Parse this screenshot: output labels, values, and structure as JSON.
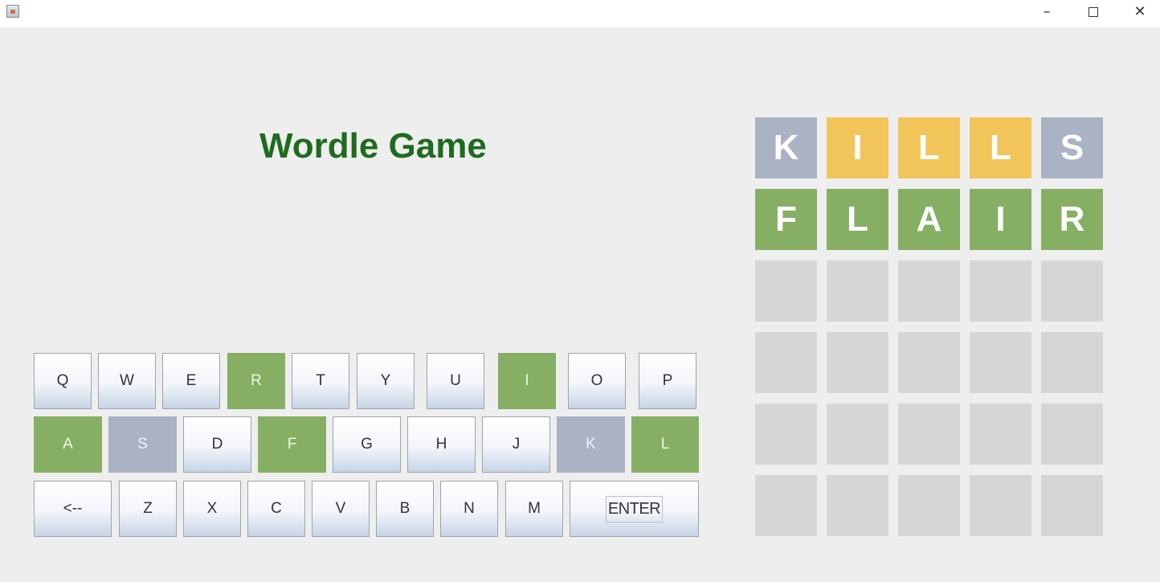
{
  "window": {
    "app_icon": "java-cup-icon",
    "minimize_glyph": "–",
    "close_glyph": "✕"
  },
  "title": "Wordle Game",
  "keyboard": {
    "row1": [
      {
        "label": "Q",
        "state": "default"
      },
      {
        "label": "W",
        "state": "default"
      },
      {
        "label": "E",
        "state": "default"
      },
      {
        "label": "R",
        "state": "green"
      },
      {
        "label": "T",
        "state": "default"
      },
      {
        "label": "Y",
        "state": "default"
      },
      {
        "label": "U",
        "state": "default"
      },
      {
        "label": "I",
        "state": "green"
      },
      {
        "label": "O",
        "state": "default"
      },
      {
        "label": "P",
        "state": "default"
      }
    ],
    "row2": [
      {
        "label": "A",
        "state": "green"
      },
      {
        "label": "S",
        "state": "gray"
      },
      {
        "label": "D",
        "state": "default"
      },
      {
        "label": "F",
        "state": "green"
      },
      {
        "label": "G",
        "state": "default"
      },
      {
        "label": "H",
        "state": "default"
      },
      {
        "label": "J",
        "state": "default"
      },
      {
        "label": "K",
        "state": "gray"
      },
      {
        "label": "L",
        "state": "green"
      }
    ],
    "row3": [
      {
        "label": "<--",
        "state": "default"
      },
      {
        "label": "Z",
        "state": "default"
      },
      {
        "label": "X",
        "state": "default"
      },
      {
        "label": "C",
        "state": "default"
      },
      {
        "label": "V",
        "state": "default"
      },
      {
        "label": "B",
        "state": "default"
      },
      {
        "label": "N",
        "state": "default"
      },
      {
        "label": "M",
        "state": "default"
      },
      {
        "label": "ENTER",
        "state": "default"
      }
    ]
  },
  "board": {
    "rows": [
      [
        {
          "letter": "K",
          "state": "gray"
        },
        {
          "letter": "I",
          "state": "yellow"
        },
        {
          "letter": "L",
          "state": "yellow"
        },
        {
          "letter": "L",
          "state": "yellow"
        },
        {
          "letter": "S",
          "state": "gray"
        }
      ],
      [
        {
          "letter": "F",
          "state": "green"
        },
        {
          "letter": "L",
          "state": "green"
        },
        {
          "letter": "A",
          "state": "green"
        },
        {
          "letter": "I",
          "state": "green"
        },
        {
          "letter": "R",
          "state": "green"
        }
      ],
      [
        {
          "letter": "",
          "state": "empty"
        },
        {
          "letter": "",
          "state": "empty"
        },
        {
          "letter": "",
          "state": "empty"
        },
        {
          "letter": "",
          "state": "empty"
        },
        {
          "letter": "",
          "state": "empty"
        }
      ],
      [
        {
          "letter": "",
          "state": "empty"
        },
        {
          "letter": "",
          "state": "empty"
        },
        {
          "letter": "",
          "state": "empty"
        },
        {
          "letter": "",
          "state": "empty"
        },
        {
          "letter": "",
          "state": "empty"
        }
      ],
      [
        {
          "letter": "",
          "state": "empty"
        },
        {
          "letter": "",
          "state": "empty"
        },
        {
          "letter": "",
          "state": "empty"
        },
        {
          "letter": "",
          "state": "empty"
        },
        {
          "letter": "",
          "state": "empty"
        }
      ],
      [
        {
          "letter": "",
          "state": "empty"
        },
        {
          "letter": "",
          "state": "empty"
        },
        {
          "letter": "",
          "state": "empty"
        },
        {
          "letter": "",
          "state": "empty"
        },
        {
          "letter": "",
          "state": "empty"
        }
      ]
    ]
  },
  "colors": {
    "title": "#1f6b1f",
    "green": "#86af64",
    "yellow": "#f2c55a",
    "gray": "#a9b3c3",
    "empty": "#d6d6d6"
  }
}
